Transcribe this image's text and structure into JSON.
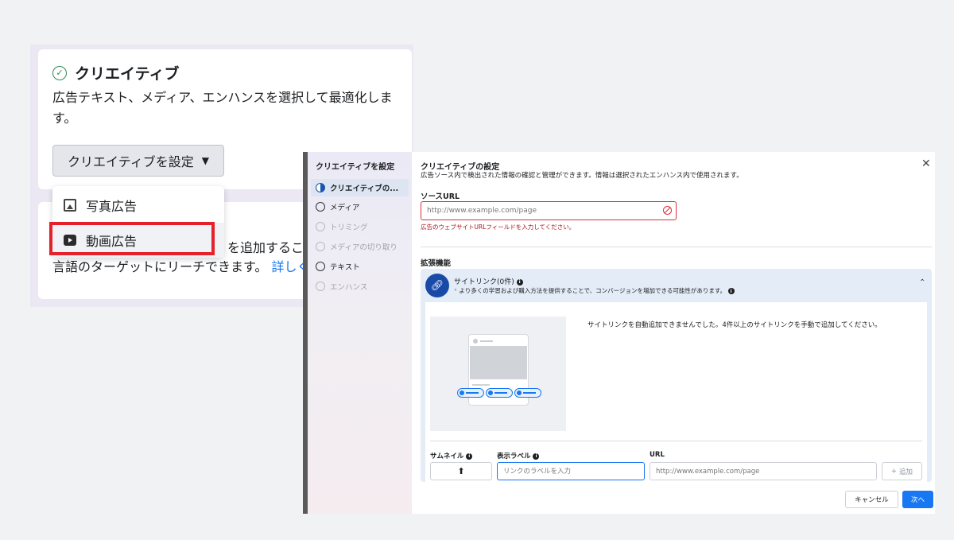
{
  "bg": {
    "creative_card": {
      "title": "クリエイティブ",
      "description": "広告テキスト、メディア、エンハンスを選択して最適化します。",
      "button_label": "クリエイティブを設定"
    },
    "second_card": {
      "text_line1": "を追加するこ",
      "text_line2": "言語のターゲットにリーチできます。",
      "link_text": "詳しく"
    },
    "dropdown": {
      "items": [
        "写真広告",
        "動画広告"
      ]
    }
  },
  "dialog": {
    "sidebar": {
      "title": "クリエイティブを設定",
      "items": [
        "クリエイティブの...",
        "メディア",
        "トリミング",
        "メディアの切り取り",
        "テキスト",
        "エンハンス"
      ]
    },
    "title": "クリエイティブの設定",
    "subtitle": "広告ソース内で検出された情報の確認と管理ができます。情報は選択されたエンハンス内で使用されます。",
    "source_url": {
      "label": "ソースURL",
      "placeholder": "http://www.example.com/page",
      "error": "広告のウェブサイトURLフィールドを入力してください。"
    },
    "extensions_label": "拡張機能",
    "sitelinks": {
      "title": "サイトリンク(0件)",
      "description": "より多くの学習および購入方法を提供することで、コンバージョンを増加できる可能性があります。",
      "message": "サイトリンクを自動追加できませんでした。4件以上のサイトリンクを手動で追加してください。",
      "col_thumbnail": "サムネイル",
      "col_label": "表示ラベル",
      "col_url": "URL",
      "label_placeholder": "リンクのラベルを入力",
      "url_placeholder": "http://www.example.com/page",
      "add_label": "追加"
    },
    "cancel_label": "キャンセル",
    "next_label": "次へ"
  },
  "colors": {
    "accent": "#1877f2",
    "error": "#d9303a",
    "highlight": "#e5212b",
    "success": "#2e8b57"
  }
}
